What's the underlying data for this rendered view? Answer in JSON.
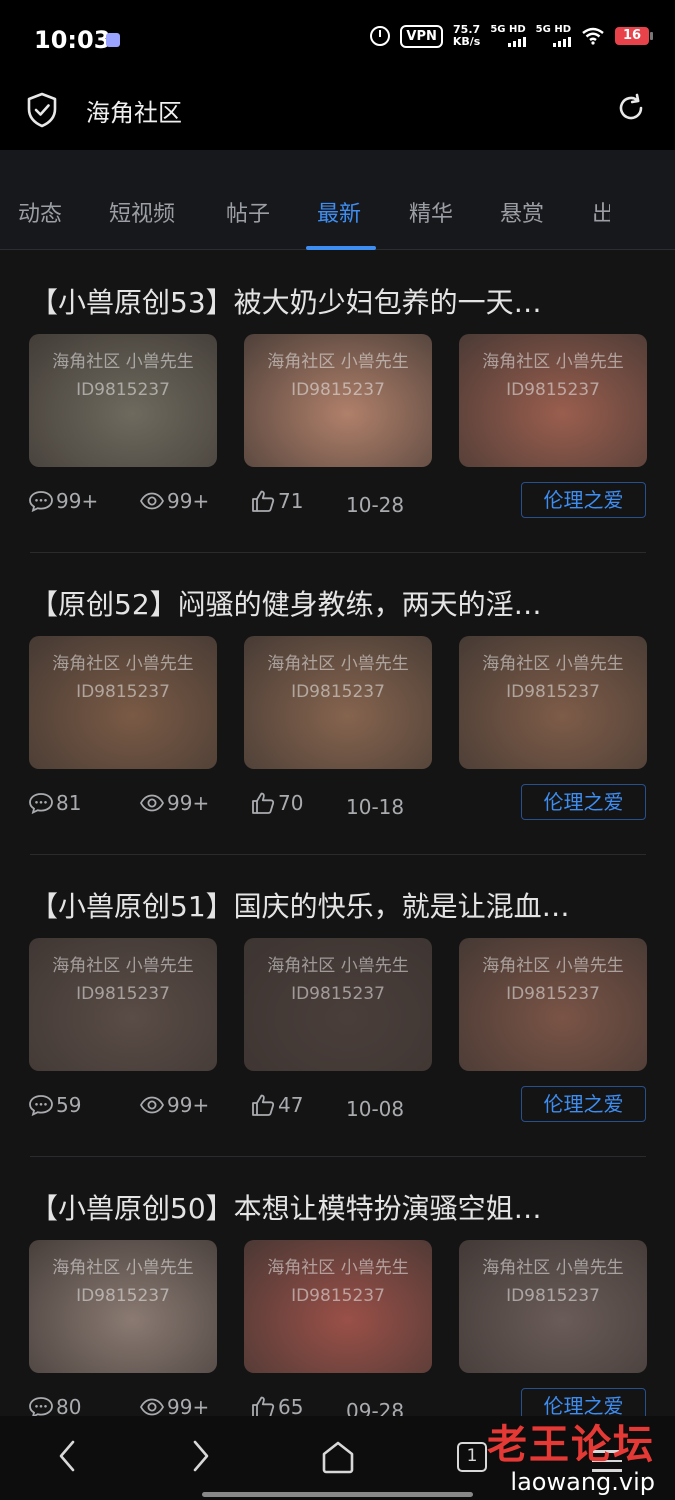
{
  "status_bar": {
    "time": "10:03",
    "vpn": "VPN",
    "speed_value": "75.7",
    "speed_unit": "KB/s",
    "sim1": "5G HD",
    "sim2": "5G HD",
    "battery": "16"
  },
  "app_bar": {
    "title": "海角社区"
  },
  "tabs": [
    {
      "label": "动态",
      "active": false
    },
    {
      "label": "短视频",
      "active": false
    },
    {
      "label": "帖子",
      "active": false
    },
    {
      "label": "最新",
      "active": true
    },
    {
      "label": "精华",
      "active": false
    },
    {
      "label": "悬赏",
      "active": false
    },
    {
      "label": "出",
      "active": false
    }
  ],
  "posts": [
    {
      "title": "【小兽原创53】被大奶少妇包养的一天…",
      "comments": "99+",
      "views": "99+",
      "likes": "71",
      "date": "10-28",
      "tag": "伦理之爱",
      "thumb_watermark_1": "海角社区 小兽先生",
      "thumb_watermark_2": "ID9815237",
      "thumb_colors": [
        "#6e6a5e",
        "#b0806a",
        "#9a5e4e"
      ]
    },
    {
      "title": "【原创52】闷骚的健身教练，两天的淫…",
      "comments": "81",
      "views": "99+",
      "likes": "70",
      "date": "10-18",
      "tag": "伦理之爱",
      "thumb_watermark_1": "海角社区 小兽先生",
      "thumb_watermark_2": "ID9815237",
      "thumb_colors": [
        "#7a5a45",
        "#86644e",
        "#7e5c48"
      ]
    },
    {
      "title": "【小兽原创51】国庆的快乐，就是让混血…",
      "comments": "59",
      "views": "99+",
      "likes": "47",
      "date": "10-08",
      "tag": "伦理之爱",
      "thumb_watermark_1": "海角社区 小兽先生",
      "thumb_watermark_2": "ID9815237",
      "thumb_colors": [
        "#5a4c46",
        "#4a3e3a",
        "#7a5446"
      ]
    },
    {
      "title": "【小兽原创50】本想让模特扮演骚空姐…",
      "comments": "80",
      "views": "99+",
      "likes": "65",
      "date": "09-28",
      "tag": "伦理之爱",
      "thumb_watermark_1": "海角社区 小兽先生",
      "thumb_watermark_2": "ID9815237",
      "thumb_colors": [
        "#8a7a72",
        "#9a5048",
        "#6a5c58"
      ]
    }
  ],
  "nav": {
    "tabs_count": "1"
  },
  "site_watermark": {
    "name": "老王论坛",
    "url": "laowang.vip"
  },
  "colors": {
    "accent": "#3e8df0",
    "background": "#141414",
    "battery": "#e8434b",
    "watermark_red": "#e53935"
  }
}
